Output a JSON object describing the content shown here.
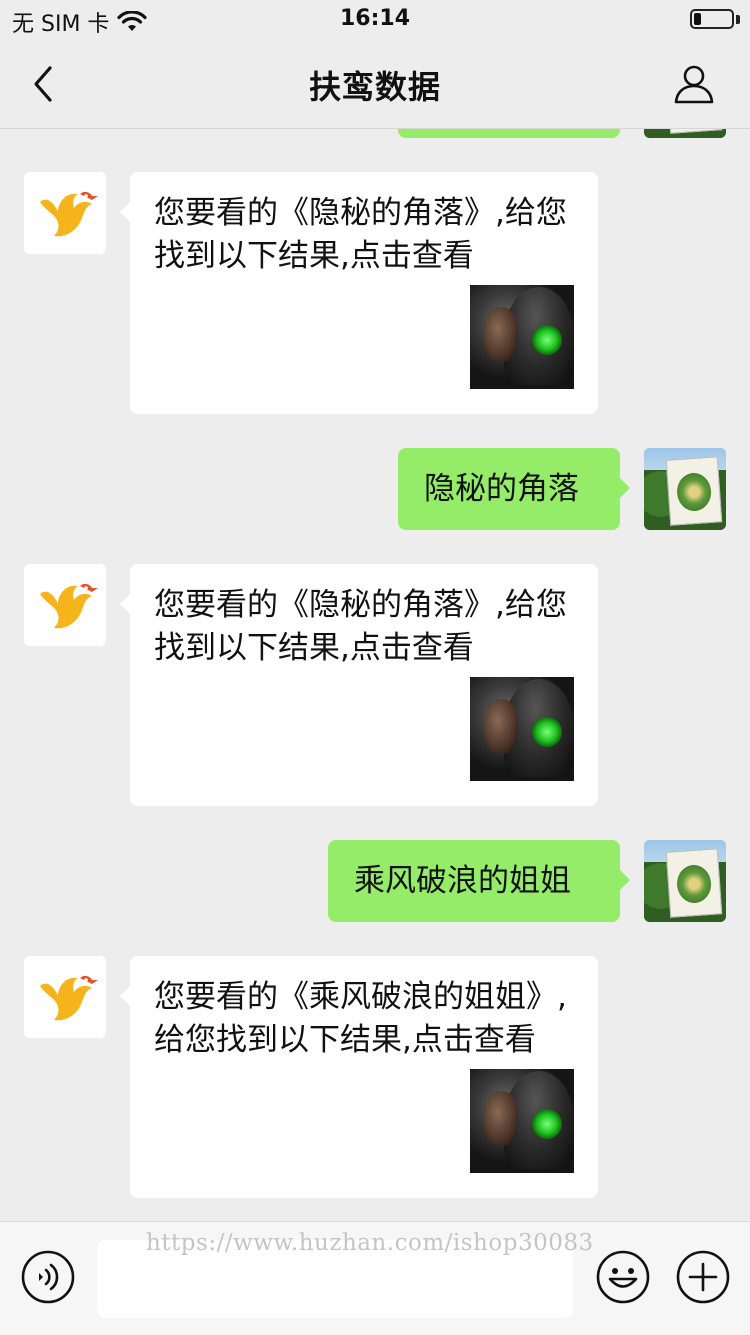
{
  "status_bar": {
    "carrier": "无 SIM 卡",
    "wifi_icon": "wifi-icon",
    "time": "16:14",
    "battery_icon": "battery-icon",
    "battery_level": 0.2
  },
  "nav": {
    "back_icon": "chevron-left-icon",
    "title": "扶鸾数据",
    "profile_icon": "person-icon"
  },
  "messages": [
    {
      "sender": "bot",
      "text": "您要看的《隐秘的角落》,给您找到以下结果,点击查看",
      "thumbnail": "hooded-figure-image"
    },
    {
      "sender": "user",
      "text": "隐秘的角落"
    },
    {
      "sender": "bot",
      "text": "您要看的《隐秘的角落》,给您找到以下结果,点击查看",
      "thumbnail": "hooded-figure-image"
    },
    {
      "sender": "user",
      "text": "乘风破浪的姐姐"
    },
    {
      "sender": "bot",
      "text": "您要看的《乘风破浪的姐姐》,给您找到以下结果,点击查看",
      "thumbnail": "hooded-figure-image"
    }
  ],
  "input_bar": {
    "voice_icon": "voice-icon",
    "input_value": "",
    "emoji_icon": "emoji-icon",
    "plus_icon": "plus-icon",
    "watermark": "https://www.huzhan.com/ishop30083"
  },
  "colors": {
    "background": "#ededed",
    "user_bubble": "#95ec69",
    "bot_bubble": "#ffffff",
    "logo_primary": "#f5b31c",
    "logo_accent": "#e8542a"
  }
}
